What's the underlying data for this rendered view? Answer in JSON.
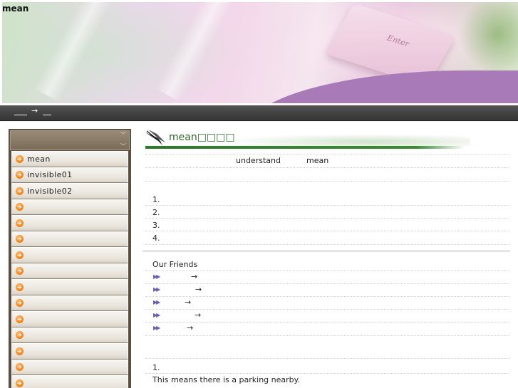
{
  "header": {
    "site_title": "mean",
    "banner_key_label": "Enter"
  },
  "navbar": {
    "arrow": "→"
  },
  "sidebar": {
    "items": [
      {
        "label": "mean"
      },
      {
        "label": "invisible01"
      },
      {
        "label": "invisible02"
      },
      {
        "label": ""
      },
      {
        "label": ""
      },
      {
        "label": ""
      },
      {
        "label": ""
      },
      {
        "label": ""
      },
      {
        "label": ""
      },
      {
        "label": ""
      },
      {
        "label": ""
      },
      {
        "label": ""
      },
      {
        "label": ""
      },
      {
        "label": ""
      },
      {
        "label": ""
      }
    ],
    "bullet_glyph": "➔"
  },
  "main": {
    "title": "mean□□□□",
    "intro_word_1": "understand",
    "intro_word_2": "mean",
    "numbered_list": [
      "1.",
      "2.",
      "3.",
      "4."
    ],
    "friends_heading": "Our Friends",
    "friends": [
      {
        "arrow": "→"
      },
      {
        "arrow": "→"
      },
      {
        "arrow": "→"
      },
      {
        "arrow": "→"
      },
      {
        "arrow": "→"
      }
    ],
    "friend_bullet": "▶▶",
    "example_number": "1.",
    "example_sentence": "This means there is a parking nearby."
  },
  "colors": {
    "title_green": "#2d6a2b",
    "rule_green": "#2b7a2a",
    "banner_purple": "#a97ab8",
    "nav_dark": "#3f3f3f",
    "sidebar_brown": "#5a4e42",
    "bullet_orange": "#f07d12",
    "friend_arrow_purple": "#6a5fb0"
  }
}
